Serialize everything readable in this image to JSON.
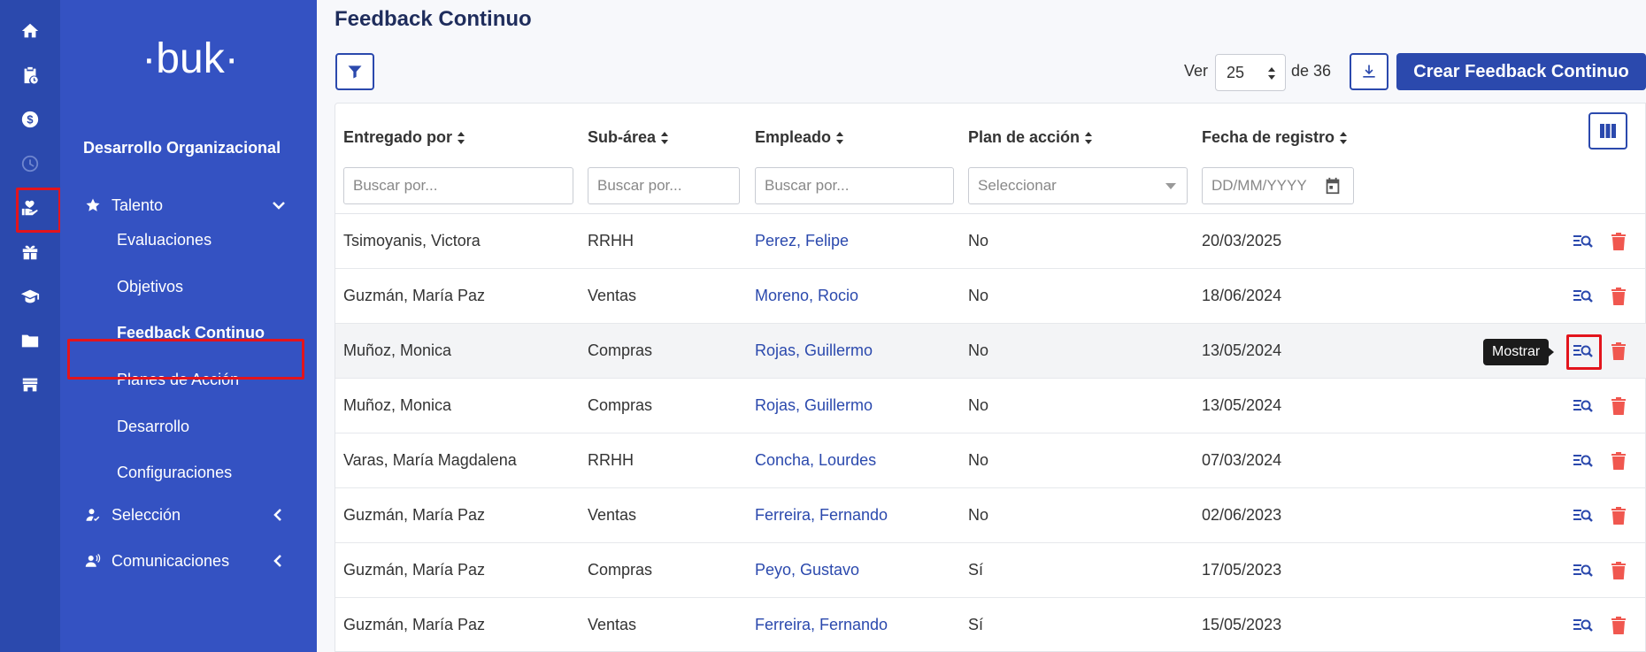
{
  "brand": {
    "logo_text": "·buk·"
  },
  "nav": {
    "section_title": "Desarrollo Organizacional",
    "talento": {
      "label": "Talento"
    },
    "sub_items": [
      "Evaluaciones",
      "Objetivos",
      "Feedback Continuo",
      "Planes de Acción",
      "Desarrollo",
      "Configuraciones"
    ],
    "active_sub_item": "Feedback Continuo",
    "seleccion": {
      "label": "Selección"
    },
    "comunicaciones": {
      "label": "Comunicaciones"
    },
    "rail_icons": [
      "home-icon",
      "clipboard-clock-icon",
      "dollar-icon",
      "clock-icon",
      "hand-heart-icon",
      "gift-icon",
      "graduation-cap-icon",
      "folder-icon",
      "store-icon"
    ],
    "active_rail_icon": "hand-heart-icon"
  },
  "page": {
    "title": "Feedback Continuo",
    "ver_label": "Ver",
    "page_size": "25",
    "de_label": "de 36",
    "create_label": "Crear Feedback Continuo"
  },
  "table": {
    "columns": [
      {
        "label": "Entregado por",
        "filter_placeholder": "Buscar por..."
      },
      {
        "label": "Sub-área",
        "filter_placeholder": "Buscar por..."
      },
      {
        "label": "Empleado",
        "filter_placeholder": "Buscar por..."
      },
      {
        "label": "Plan de acción",
        "filter_placeholder": "Seleccionar"
      },
      {
        "label": "Fecha de registro",
        "filter_placeholder": "DD/MM/YYYY"
      }
    ],
    "rows": [
      {
        "entregado_por": "Tsimoyanis, Victora",
        "sub_area": "RRHH",
        "empleado": "Perez, Felipe",
        "plan": "No",
        "fecha": "20/03/2025"
      },
      {
        "entregado_por": "Guzmán, María Paz",
        "sub_area": "Ventas",
        "empleado": "Moreno, Rocio",
        "plan": "No",
        "fecha": "18/06/2024"
      },
      {
        "entregado_por": "Muñoz, Monica",
        "sub_area": "Compras",
        "empleado": "Rojas, Guillermo",
        "plan": "No",
        "fecha": "13/05/2024"
      },
      {
        "entregado_por": "Muñoz, Monica",
        "sub_area": "Compras",
        "empleado": "Rojas, Guillermo",
        "plan": "No",
        "fecha": "13/05/2024"
      },
      {
        "entregado_por": "Varas, María Magdalena",
        "sub_area": "RRHH",
        "empleado": "Concha, Lourdes",
        "plan": "No",
        "fecha": "07/03/2024"
      },
      {
        "entregado_por": "Guzmán, María Paz",
        "sub_area": "Ventas",
        "empleado": "Ferreira, Fernando",
        "plan": "No",
        "fecha": "02/06/2023"
      },
      {
        "entregado_por": "Guzmán, María Paz",
        "sub_area": "Compras",
        "empleado": "Peyo, Gustavo",
        "plan": "Sí",
        "fecha": "17/05/2023"
      },
      {
        "entregado_por": "Guzmán, María Paz",
        "sub_area": "Ventas",
        "empleado": "Ferreira, Fernando",
        "plan": "Sí",
        "fecha": "15/05/2023"
      }
    ],
    "tooltip": "Mostrar",
    "hover_row_index": 2
  },
  "colors": {
    "rail": "#2b49ad",
    "menu": "#3452c2",
    "accent": "#2b49ad",
    "delete": "#f0574f",
    "highlight": "#e3141c"
  }
}
